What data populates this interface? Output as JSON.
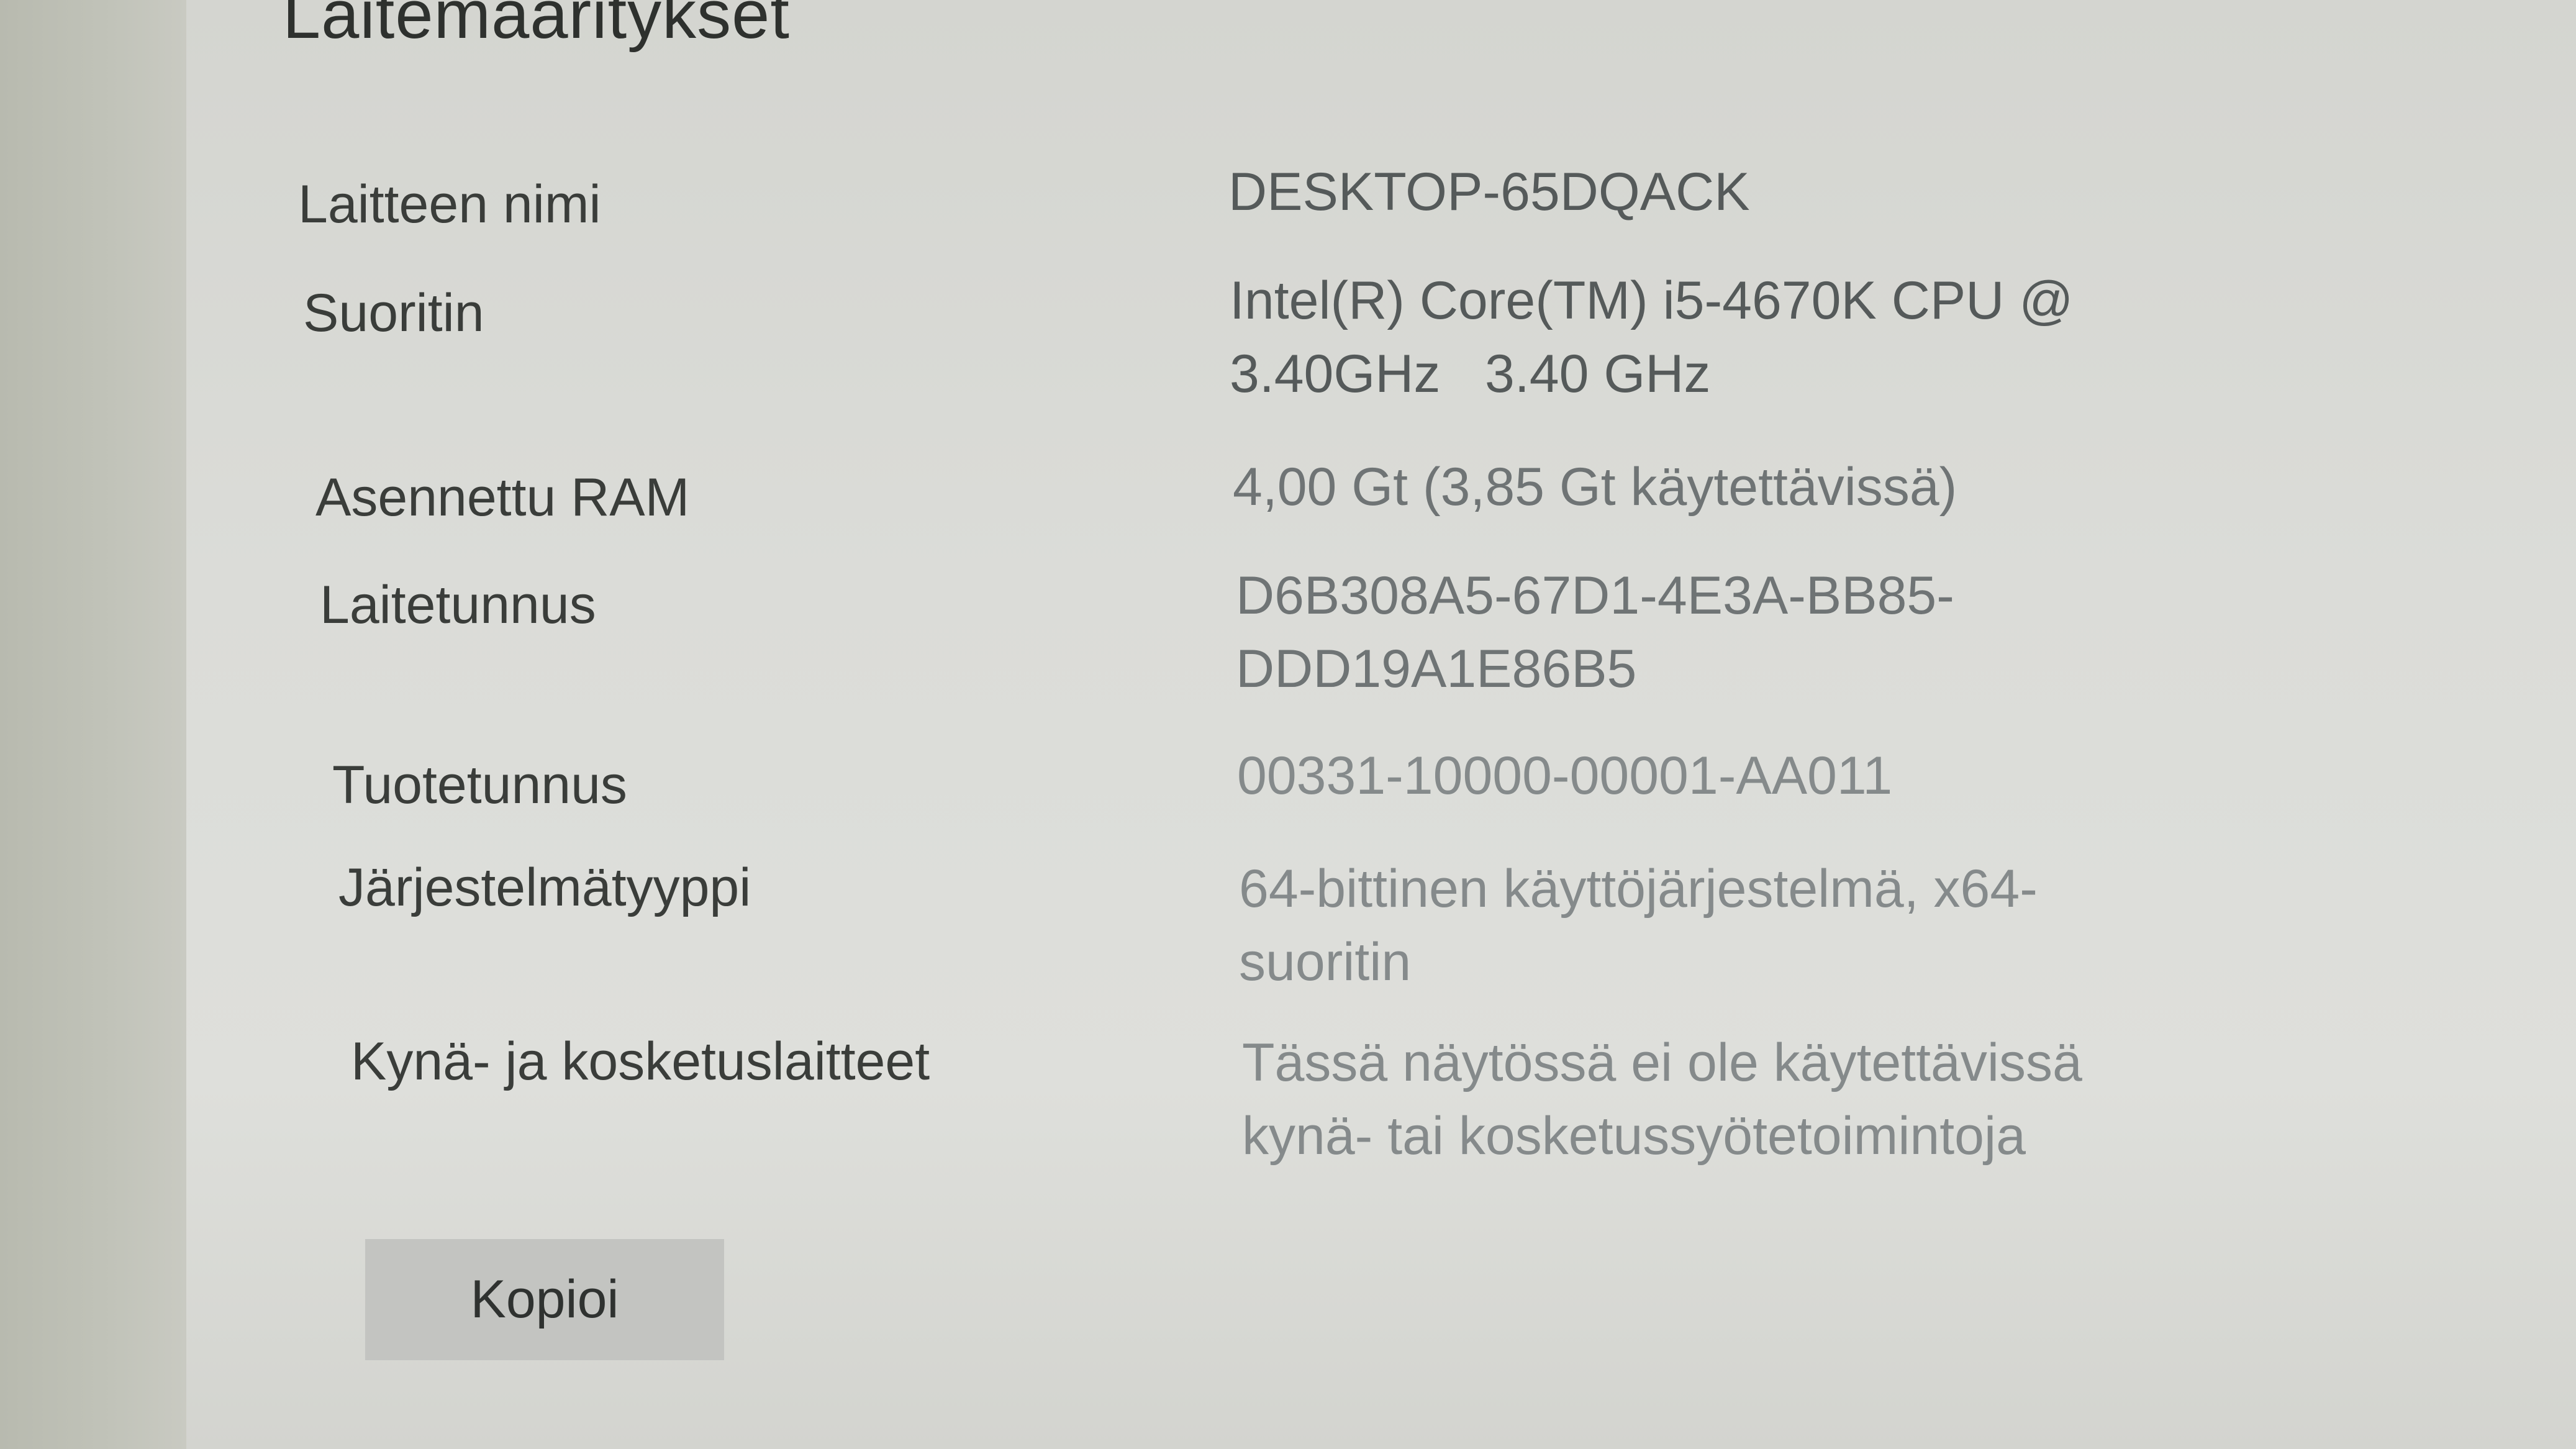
{
  "section": {
    "title": "Laitemääritykset"
  },
  "specs": [
    {
      "label": "Laitteen nimi",
      "value_lines": [
        "DESKTOP-65DQACK"
      ]
    },
    {
      "label": "Suoritin",
      "value_lines": [
        "Intel(R) Core(TM) i5-4670K CPU @",
        "3.40GHz   3.40 GHz"
      ]
    },
    {
      "label": "Asennettu RAM",
      "value_lines": [
        "4,00 Gt (3,85 Gt käytettävissä)"
      ]
    },
    {
      "label": "Laitetunnus",
      "value_lines": [
        "D6B308A5-67D1-4E3A-BB85-",
        "DDD19A1E86B5"
      ]
    },
    {
      "label": "Tuotetunnus",
      "value_lines": [
        "00331-10000-00001-AA011"
      ]
    },
    {
      "label": "Järjestelmätyyppi",
      "value_lines": [
        "64-bittinen käyttöjärjestelmä, x64-",
        "suoritin"
      ]
    },
    {
      "label": "Kynä- ja kosketuslaitteet",
      "value_lines": [
        "Tässä näytössä ei ole käytettävissä",
        "kynä- tai kosketussyötetoimintoja"
      ]
    }
  ],
  "actions": {
    "copy_label": "Kopioi"
  }
}
